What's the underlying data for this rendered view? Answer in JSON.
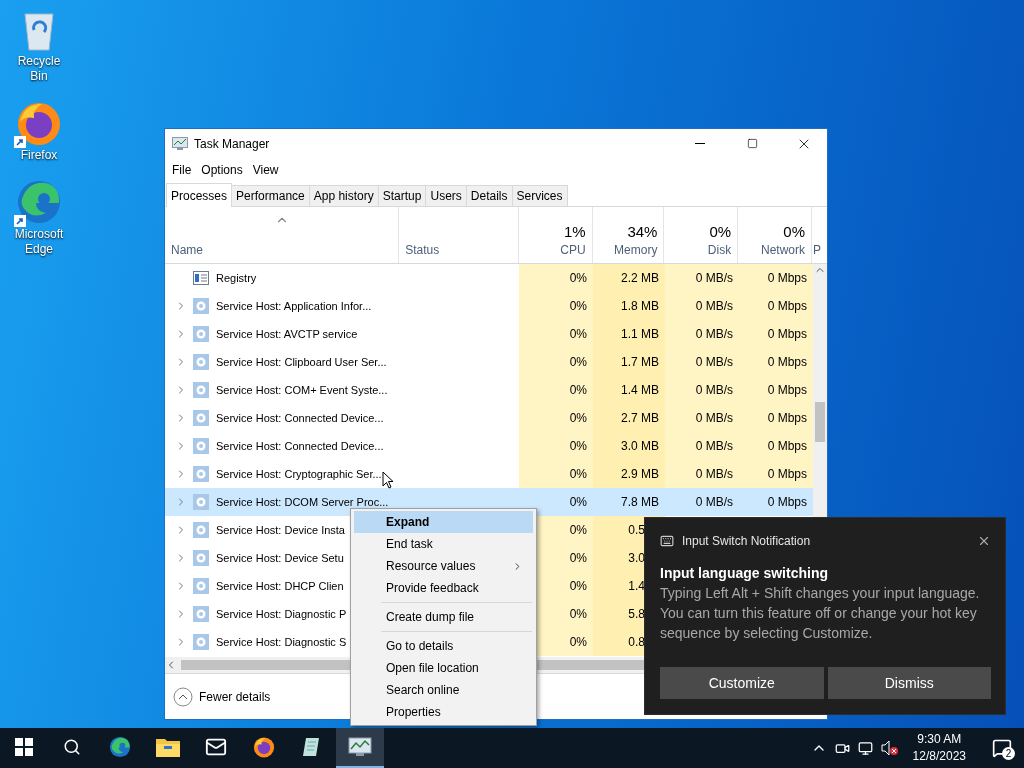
{
  "desktop_icons": [
    {
      "label": "Recycle Bin",
      "kind": "recycle",
      "shortcut": false
    },
    {
      "label": "Firefox",
      "kind": "firefox",
      "shortcut": true
    },
    {
      "label": "Microsoft Edge",
      "kind": "edge",
      "shortcut": true
    }
  ],
  "window": {
    "title": "Task Manager",
    "menu": [
      "File",
      "Options",
      "View"
    ],
    "tabs": [
      {
        "label": "Processes",
        "selected": true
      },
      {
        "label": "Performance",
        "selected": false
      },
      {
        "label": "App history",
        "selected": false
      },
      {
        "label": "Startup",
        "selected": false
      },
      {
        "label": "Users",
        "selected": false
      },
      {
        "label": "Details",
        "selected": false
      },
      {
        "label": "Services",
        "selected": false
      }
    ],
    "columns": [
      {
        "label": "Name",
        "sorted": true
      },
      {
        "label": "Status",
        "sorted": false
      },
      {
        "total": "1%",
        "label": "CPU",
        "sorted": false
      },
      {
        "total": "34%",
        "label": "Memory",
        "sorted": false
      },
      {
        "total": "0%",
        "label": "Disk",
        "sorted": false
      },
      {
        "total": "0%",
        "label": "Network",
        "sorted": false
      },
      {
        "label": "P",
        "sorted": false
      }
    ],
    "rows": [
      {
        "name": "Registry",
        "kind": "registry",
        "expandable": false,
        "selected": false,
        "cpu": "0%",
        "memory": "2.2 MB",
        "disk": "0 MB/s",
        "network": "0 Mbps"
      },
      {
        "name": "Service Host: Application Infor...",
        "kind": "service",
        "expandable": true,
        "selected": false,
        "cpu": "0%",
        "memory": "1.8 MB",
        "disk": "0 MB/s",
        "network": "0 Mbps"
      },
      {
        "name": "Service Host: AVCTP service",
        "kind": "service",
        "expandable": true,
        "selected": false,
        "cpu": "0%",
        "memory": "1.1 MB",
        "disk": "0 MB/s",
        "network": "0 Mbps"
      },
      {
        "name": "Service Host: Clipboard User Ser...",
        "kind": "service",
        "expandable": true,
        "selected": false,
        "cpu": "0%",
        "memory": "1.7 MB",
        "disk": "0 MB/s",
        "network": "0 Mbps"
      },
      {
        "name": "Service Host: COM+ Event Syste...",
        "kind": "service",
        "expandable": true,
        "selected": false,
        "cpu": "0%",
        "memory": "1.4 MB",
        "disk": "0 MB/s",
        "network": "0 Mbps"
      },
      {
        "name": "Service Host: Connected Device...",
        "kind": "service",
        "expandable": true,
        "selected": false,
        "cpu": "0%",
        "memory": "2.7 MB",
        "disk": "0 MB/s",
        "network": "0 Mbps"
      },
      {
        "name": "Service Host: Connected Device...",
        "kind": "service",
        "expandable": true,
        "selected": false,
        "cpu": "0%",
        "memory": "3.0 MB",
        "disk": "0 MB/s",
        "network": "0 Mbps"
      },
      {
        "name": "Service Host: Cryptographic Ser...",
        "kind": "service",
        "expandable": true,
        "selected": false,
        "cpu": "0%",
        "memory": "2.9 MB",
        "disk": "0 MB/s",
        "network": "0 Mbps"
      },
      {
        "name": "Service Host: DCOM Server Proc...",
        "kind": "service",
        "expandable": true,
        "selected": true,
        "cpu": "0%",
        "memory": "7.8 MB",
        "disk": "0 MB/s",
        "network": "0 Mbps"
      },
      {
        "name": "Service Host: Device Insta",
        "kind": "service",
        "expandable": true,
        "selected": false,
        "cpu": "0%",
        "memory": "0.5"
      },
      {
        "name": "Service Host: Device Setu",
        "kind": "service",
        "expandable": true,
        "selected": false,
        "cpu": "0%",
        "memory": "3.0"
      },
      {
        "name": "Service Host: DHCP Clien",
        "kind": "service",
        "expandable": true,
        "selected": false,
        "cpu": "0%",
        "memory": "1.4"
      },
      {
        "name": "Service Host: Diagnostic P",
        "kind": "service",
        "expandable": true,
        "selected": false,
        "cpu": "0%",
        "memory": "5.8"
      },
      {
        "name": "Service Host: Diagnostic S",
        "kind": "service",
        "expandable": true,
        "selected": false,
        "cpu": "0%",
        "memory": "0.8"
      }
    ],
    "footer": {
      "label": "Fewer details"
    }
  },
  "context_menu": [
    {
      "kind": "item",
      "label": "Expand",
      "selected": true,
      "submenu": false
    },
    {
      "kind": "item",
      "label": "End task",
      "selected": false,
      "submenu": false
    },
    {
      "kind": "item",
      "label": "Resource values",
      "selected": false,
      "submenu": true
    },
    {
      "kind": "item",
      "label": "Provide feedback",
      "selected": false,
      "submenu": false
    },
    {
      "kind": "separator"
    },
    {
      "kind": "item",
      "label": "Create dump file",
      "selected": false,
      "submenu": false
    },
    {
      "kind": "separator"
    },
    {
      "kind": "item",
      "label": "Go to details",
      "selected": false,
      "submenu": false
    },
    {
      "kind": "item",
      "label": "Open file location",
      "selected": false,
      "submenu": false
    },
    {
      "kind": "item",
      "label": "Search online",
      "selected": false,
      "submenu": false
    },
    {
      "kind": "item",
      "label": "Properties",
      "selected": false,
      "submenu": false
    }
  ],
  "notification": {
    "app": "Input Switch Notification",
    "heading": "Input language switching",
    "body": "Typing Left Alt + Shift changes your input language. You can turn this feature off or change your hot key sequence by selecting Customize.",
    "buttons": [
      "Customize",
      "Dismiss"
    ]
  },
  "taskbar": {
    "apps": [
      {
        "kind": "start",
        "active": false
      },
      {
        "kind": "search",
        "active": false
      },
      {
        "kind": "edge",
        "active": false
      },
      {
        "kind": "explorer",
        "active": false
      },
      {
        "kind": "mail",
        "active": false
      },
      {
        "kind": "firefox",
        "active": false
      },
      {
        "kind": "notepad",
        "active": false
      },
      {
        "kind": "taskmgr",
        "active": true
      }
    ],
    "time": "9:30 AM",
    "date": "12/8/2023",
    "notification_count": "2"
  }
}
